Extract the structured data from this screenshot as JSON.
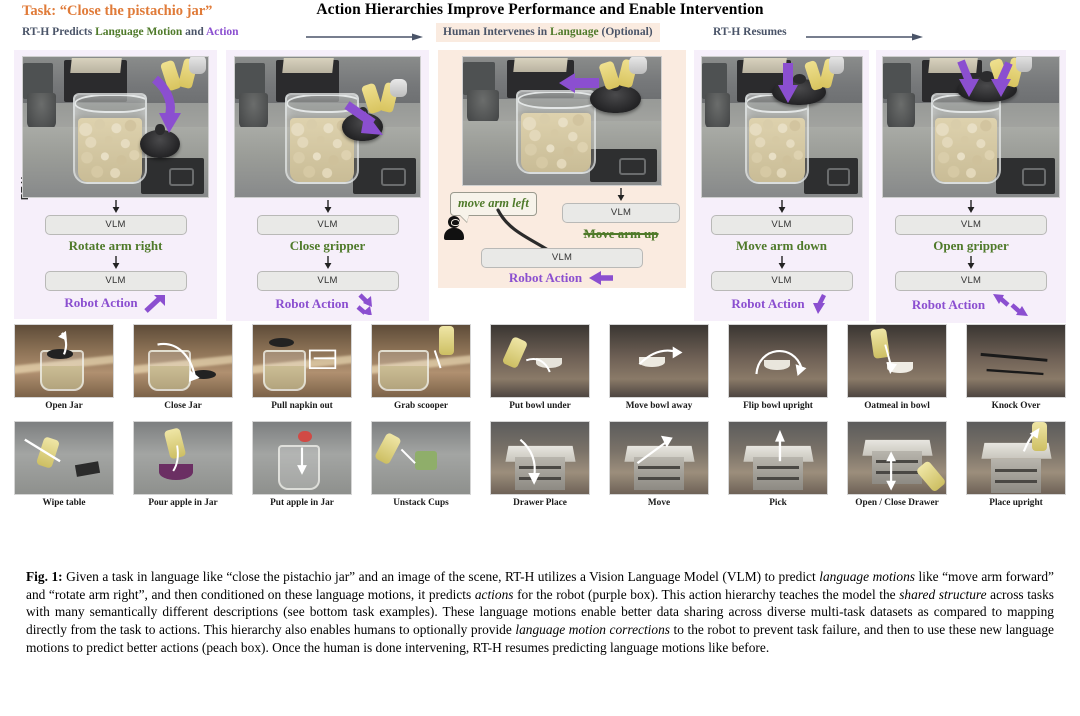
{
  "header": {
    "task_label": "Task: “Close the pistachio jar”",
    "figure_title": "Action Hierarchies Improve Performance and Enable Intervention",
    "task_color": "#E07B39"
  },
  "legend": {
    "stage1_prefix": "RT-H Predicts ",
    "stage1_language": "Language Motion",
    "stage1_mid": " and ",
    "stage1_action": "Action",
    "stage2_prefix": "Human Intervenes in ",
    "stage2_language": "Language",
    "stage2_suffix": " (Optional)",
    "stage3": "RT-H Resumes",
    "language_color": "#4F7A2A",
    "action_color": "#8B4FD0",
    "text_color": "#4A5468",
    "peach_bg": "#FAEBE0",
    "purple_bg": "#F6EFFA"
  },
  "pipeline": {
    "side_label": "RT-H",
    "vlm_label": "VLM",
    "robot_action_label": "Robot Action",
    "panels": [
      {
        "id": "panel-rotate-arm-right",
        "bg": "purple",
        "language_motion": "Rotate arm right",
        "struck": false,
        "robot_action": "Robot Action",
        "action_arrow": "up-right",
        "scene_arrow": "down-left-curve"
      },
      {
        "id": "panel-close-gripper",
        "bg": "purple",
        "language_motion": "Close gripper",
        "struck": false,
        "robot_action": "Robot Action",
        "action_arrow": "pinch",
        "scene_arrow": "down-right"
      },
      {
        "id": "panel-human-intervention",
        "bg": "peach",
        "language_motion": "Move arm up",
        "struck": true,
        "correction": "move arm left",
        "robot_action": "Robot Action",
        "action_arrow": "left",
        "scene_arrow": "left"
      },
      {
        "id": "panel-move-arm-down",
        "bg": "purple",
        "language_motion": "Move arm down",
        "struck": false,
        "robot_action": "Robot Action",
        "action_arrow": "down",
        "scene_arrow": "down"
      },
      {
        "id": "panel-open-gripper",
        "bg": "purple",
        "language_motion": "Open gripper",
        "struck": false,
        "robot_action": "Robot Action",
        "action_arrow": "spread",
        "scene_arrow": "down-pair"
      }
    ]
  },
  "task_grid": {
    "row1": [
      {
        "label": "Open Jar",
        "scene": "wood",
        "motif": "jar-lid-up"
      },
      {
        "label": "Close Jar",
        "scene": "wood",
        "motif": "jar-lid-down"
      },
      {
        "label": "Pull napkin out",
        "scene": "wood",
        "motif": "napkin"
      },
      {
        "label": "Grab scooper",
        "scene": "wood",
        "motif": "scooper"
      },
      {
        "label": "Put bowl under",
        "scene": "dark",
        "motif": "bowl-under"
      },
      {
        "label": "Move bowl away",
        "scene": "dark",
        "motif": "bowl-away"
      },
      {
        "label": "Flip bowl upright",
        "scene": "dark",
        "motif": "bowl-flip"
      },
      {
        "label": "Oatmeal in bowl",
        "scene": "dark",
        "motif": "oatmeal"
      },
      {
        "label": "Knock Over",
        "scene": "dark",
        "motif": "knock"
      }
    ],
    "row2": [
      {
        "label": "Wipe table",
        "scene": "grey",
        "motif": "wipe"
      },
      {
        "label": "Pour apple in Jar",
        "scene": "grey",
        "motif": "pour"
      },
      {
        "label": "Put apple in Jar",
        "scene": "grey",
        "motif": "apple-jar"
      },
      {
        "label": "Unstack Cups",
        "scene": "grey",
        "motif": "cups"
      },
      {
        "label": "Drawer Place",
        "scene": "office",
        "motif": "drawer-place"
      },
      {
        "label": "Move",
        "scene": "office",
        "motif": "move"
      },
      {
        "label": "Pick",
        "scene": "office",
        "motif": "pick"
      },
      {
        "label": "Open / Close Drawer",
        "scene": "office",
        "motif": "drawer-open"
      },
      {
        "label": "Place upright",
        "scene": "office",
        "motif": "place-upright"
      }
    ]
  },
  "caption": {
    "figure_number": "Fig. 1:",
    "part1": " Given a task in language like “close the pistachio jar” and an image of the scene, RT-H utilizes a Vision Language Model (VLM) to predict ",
    "em1": "language motions",
    "part2": " like “move arm forward” and “rotate arm right”, and then conditioned on these language motions, it predicts ",
    "em2": "actions",
    "part3": " for the robot (purple box). This action hierarchy teaches the model the ",
    "em3": "shared structure",
    "part4": " across tasks with many semantically different descriptions (see bottom task examples). These language motions enable better data sharing across diverse multi-task datasets as compared to mapping directly from the task to actions. This hierarchy also enables humans to optionally provide ",
    "em4": "language motion corrections",
    "part5": " to the robot to prevent task failure, and then to use these new language motions to predict better actions (peach box). Once the human is done intervening, RT-H resumes predicting language motions like before."
  }
}
